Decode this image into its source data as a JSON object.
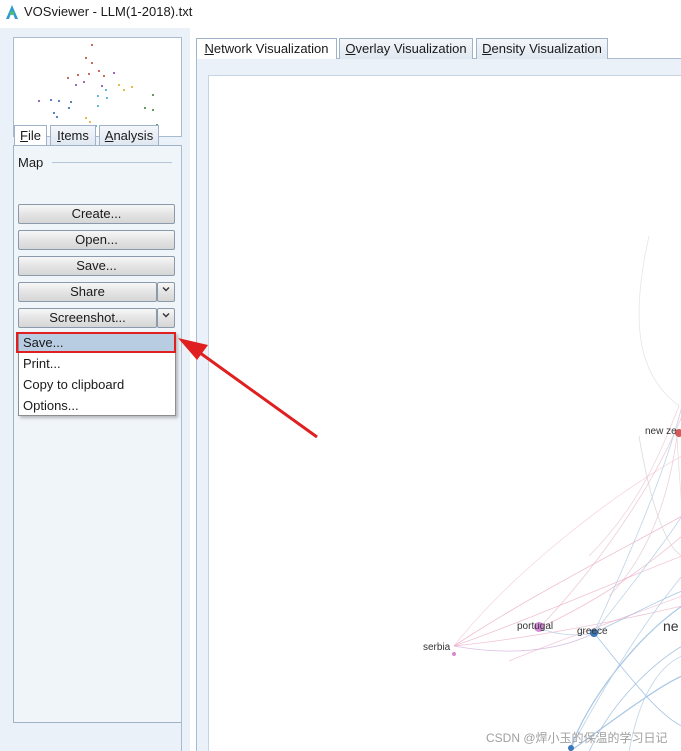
{
  "window": {
    "title": "VOSviewer - LLM(1-2018).txt",
    "icon": "vosviewer-app-icon"
  },
  "left_tabs": [
    {
      "label": "File",
      "mnemonic": "F",
      "rest": "ile"
    },
    {
      "label": "Items",
      "mnemonic": "I",
      "rest": "tems"
    },
    {
      "label": "Analysis",
      "mnemonic": "A",
      "rest": "nalysis"
    }
  ],
  "map_group": {
    "label": "Map",
    "create": "Create...",
    "open": "Open...",
    "save": "Save...",
    "share": "Share",
    "screenshot": "Screenshot..."
  },
  "screenshot_menu": [
    {
      "label": "Save...",
      "highlighted": true
    },
    {
      "label": "Print..."
    },
    {
      "label": "Copy to clipboard"
    },
    {
      "label": "Options..."
    }
  ],
  "main_tabs": [
    {
      "label": "Network Visualization",
      "mnemonic": "N",
      "rest": "etwork Visualization",
      "active": true
    },
    {
      "label": "Overlay Visualization",
      "mnemonic": "O",
      "rest": "verlay Visualization"
    },
    {
      "label": "Density Visualization",
      "mnemonic": "D",
      "rest": "ensity Visualization"
    }
  ],
  "network_labels": {
    "new_zealand": "new ze",
    "portugal": "portugal",
    "greece": "greece",
    "netherlands": "ne",
    "serbia": "serbia"
  },
  "watermark": "CSDN @焊小玉的保温的学习日记",
  "colors": {
    "annotation_red": "#e02020",
    "menu_highlight": "#b9cde2",
    "panel_bg": "#eaf1f8"
  }
}
